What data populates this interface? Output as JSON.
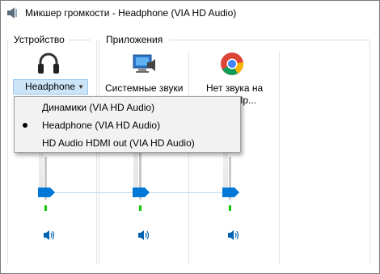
{
  "window": {
    "title": "Микшер громкости - Headphone (VIA HD Audio)"
  },
  "groups": {
    "device_label": "Устройство",
    "apps_label": "Приложения"
  },
  "device": {
    "selected": "Headphone",
    "icon": "headphones-icon"
  },
  "apps": [
    {
      "name": "Системные звуки",
      "icon": "system-sounds-icon"
    },
    {
      "name_line1": "Нет звука на",
      "name_line2": "...ере. Пр...",
      "icon": "chrome-icon"
    }
  ],
  "dropdown": {
    "items": [
      {
        "label": "Динамики (VIA HD Audio)",
        "selected": false
      },
      {
        "label": "Headphone (VIA HD Audio)",
        "selected": true
      },
      {
        "label": "HD Audio HDMI out (VIA HD Audio)",
        "selected": false
      }
    ]
  },
  "volume_level": 1.0,
  "colors": {
    "accent": "#0078d7",
    "selection": "#cce4f7",
    "meter": "#16c60c"
  }
}
